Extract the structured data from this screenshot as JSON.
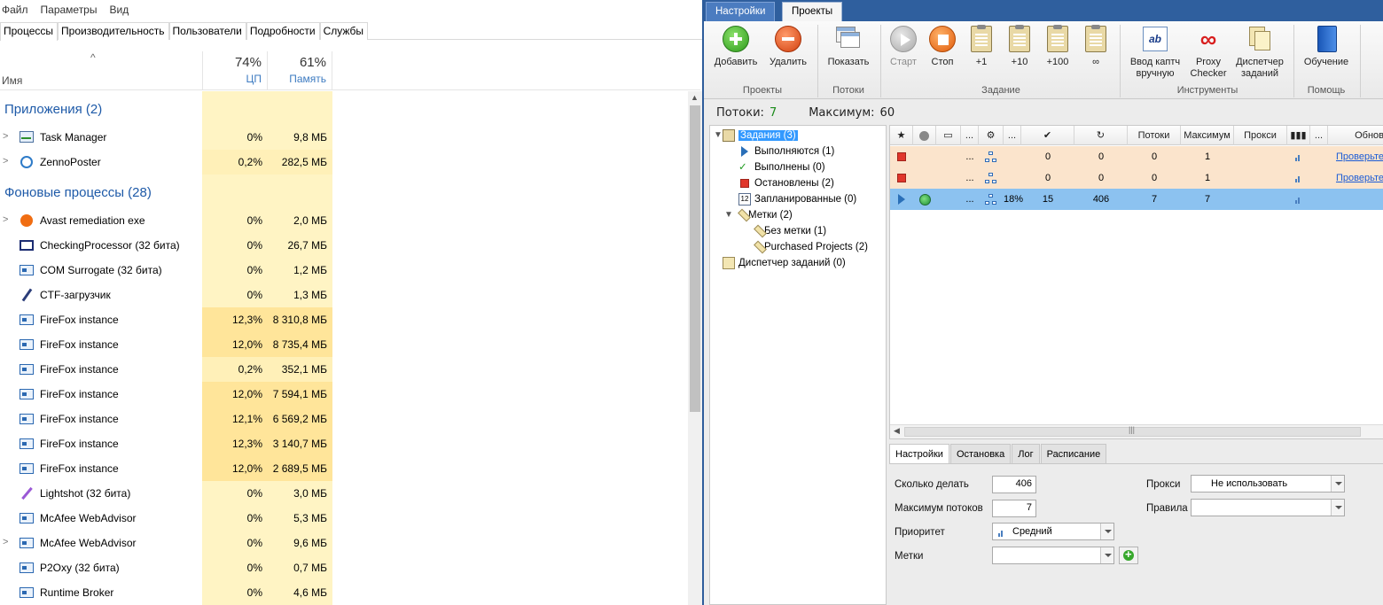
{
  "taskmgr": {
    "menu": [
      "Файл",
      "Параметры",
      "Вид"
    ],
    "tabs": [
      "Процессы",
      "Производительность",
      "Пользователи",
      "Подробности",
      "Службы"
    ],
    "header": {
      "name_label": "Имя",
      "cpu_pct": "74%",
      "cpu_label": "ЦП",
      "mem_pct": "61%",
      "mem_label": "Память"
    },
    "groups": {
      "apps": "Приложения (2)",
      "background": "Фоновые процессы (28)"
    },
    "apps": [
      {
        "name": "Task Manager",
        "cpu": "0%",
        "mem": "9,8 МБ",
        "icon": "taskmgr-icon",
        "expand": true
      },
      {
        "name": "ZennoPoster",
        "cpu": "0,2%",
        "mem": "282,5 МБ",
        "icon": "zennoposter-icon",
        "expand": true
      }
    ],
    "background": [
      {
        "name": "Avast remediation exe",
        "cpu": "0%",
        "mem": "2,0 МБ",
        "icon": "avast-icon",
        "expand": true
      },
      {
        "name": "CheckingProcessor (32 бита)",
        "cpu": "0%",
        "mem": "26,7 МБ",
        "icon": "window-icon",
        "expand": false
      },
      {
        "name": "COM Surrogate (32 бита)",
        "cpu": "0%",
        "mem": "1,2 МБ",
        "icon": "service-icon",
        "expand": false
      },
      {
        "name": "CTF-загрузчик",
        "cpu": "0%",
        "mem": "1,3 МБ",
        "icon": "pen-icon",
        "expand": false
      },
      {
        "name": "FireFox instance",
        "cpu": "12,3%",
        "mem": "8 310,8 МБ",
        "icon": "service-icon",
        "expand": false
      },
      {
        "name": "FireFox instance",
        "cpu": "12,0%",
        "mem": "8 735,4 МБ",
        "icon": "service-icon",
        "expand": false
      },
      {
        "name": "FireFox instance",
        "cpu": "0,2%",
        "mem": "352,1 МБ",
        "icon": "service-icon",
        "expand": false
      },
      {
        "name": "FireFox instance",
        "cpu": "12,0%",
        "mem": "7 594,1 МБ",
        "icon": "service-icon",
        "expand": false
      },
      {
        "name": "FireFox instance",
        "cpu": "12,1%",
        "mem": "6 569,2 МБ",
        "icon": "service-icon",
        "expand": false
      },
      {
        "name": "FireFox instance",
        "cpu": "12,3%",
        "mem": "3 140,7 МБ",
        "icon": "service-icon",
        "expand": false
      },
      {
        "name": "FireFox instance",
        "cpu": "12,0%",
        "mem": "2 689,5 МБ",
        "icon": "service-icon",
        "expand": false
      },
      {
        "name": "Lightshot (32 бита)",
        "cpu": "0%",
        "mem": "3,0 МБ",
        "icon": "feather-icon",
        "expand": false
      },
      {
        "name": "McAfee WebAdvisor",
        "cpu": "0%",
        "mem": "5,3 МБ",
        "icon": "service-icon",
        "expand": false
      },
      {
        "name": "McAfee WebAdvisor",
        "cpu": "0%",
        "mem": "9,6 МБ",
        "icon": "service-icon",
        "expand": true
      },
      {
        "name": "P2Oxy (32 бита)",
        "cpu": "0%",
        "mem": "0,7 МБ",
        "icon": "service-icon",
        "expand": false
      },
      {
        "name": "Runtime Broker",
        "cpu": "0%",
        "mem": "4,6 МБ",
        "icon": "service-icon",
        "expand": false
      }
    ]
  },
  "zenno": {
    "tabs": [
      "Настройки",
      "Проекты"
    ],
    "ribbon": {
      "add": "Добавить",
      "delete": "Удалить",
      "show": "Показать",
      "start": "Старт",
      "stop": "Стоп",
      "plus1": "+1",
      "plus10": "+10",
      "plus100": "+100",
      "infinity": "∞",
      "captcha": "Ввод каптч вручную",
      "proxy": "Proxy Checker",
      "dispatcher": "Диспетчер заданий",
      "training": "Обучение",
      "group_projects": "Проекты",
      "group_threads": "Потоки",
      "group_task": "Задание",
      "group_tools": "Инструменты",
      "group_help": "Помощь"
    },
    "status": {
      "threads_label": "Потоки:",
      "threads_value": "7",
      "max_label": "Максимум:",
      "max_value": "60"
    },
    "tree": {
      "tasks": "Задания (3)",
      "running": "Выполняются (1)",
      "done": "Выполнены (0)",
      "stopped": "Остановлены (2)",
      "scheduled": "Запланированные (0)",
      "labels": "Метки (2)",
      "no_label": "Без метки (1)",
      "purchased": "Purchased Projects (2)",
      "dispatcher": "Диспетчер заданий (0)"
    },
    "grid": {
      "headers": {
        "dots1": "...",
        "dots2": "...",
        "threads": "Потоки",
        "maximum": "Максимум",
        "proxy": "Прокси",
        "dots3": "...",
        "update": "Обнов"
      },
      "rows": [
        {
          "status": "stopped",
          "pct": "",
          "done": "0",
          "runs": "0",
          "threads": "0",
          "max": "1",
          "link": "Проверьте"
        },
        {
          "status": "stopped",
          "pct": "",
          "done": "0",
          "runs": "0",
          "threads": "0",
          "max": "1",
          "link": "Проверьте"
        },
        {
          "status": "running",
          "pct": "18%",
          "done": "15",
          "runs": "406",
          "threads": "7",
          "max": "7",
          "link": ""
        }
      ],
      "row_dots": "..."
    },
    "bottom_tabs": [
      "Настройки",
      "Остановка",
      "Лог",
      "Расписание"
    ],
    "settings": {
      "how_many_label": "Сколько делать",
      "how_many_value": "406",
      "max_threads_label": "Максимум потоков",
      "max_threads_value": "7",
      "priority_label": "Приоритет",
      "priority_value": "Средний",
      "labels_label": "Метки",
      "labels_value": "",
      "proxy_label": "Прокси",
      "proxy_value": "Не использовать",
      "rules_label": "Правила",
      "rules_value": ""
    }
  }
}
